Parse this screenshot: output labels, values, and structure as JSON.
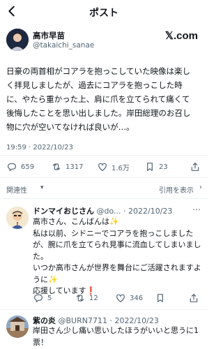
{
  "header": {
    "title": "ポスト",
    "back_icon": "arrow-left-icon"
  },
  "post": {
    "author_name": "高市早苗",
    "author_handle": "@takaichi_sanae",
    "brand_logo": "𝕏.com",
    "text_lines": [
      "日豪の両首相がコアラを抱っこしていた映像は楽し",
      "く拝見しましたが、過去にコアラを抱っこした時",
      "に、やたら重かった上、肩に爪を立てられて痛くて",
      "後悔したことを思い出しました。岸田総理のお召し",
      "物に穴が空いてなければ良いが…。"
    ],
    "timestamp": "19:59 · 2022/10/23",
    "stats": {
      "replies": "659",
      "reposts": "1317",
      "likes": "1.6万",
      "bookmarks": "23"
    }
  },
  "related": {
    "label": "関連性",
    "quote_link": "引用を表示"
  },
  "replies": [
    {
      "name": "ドンマイおじさん",
      "meta": "@do... · 2022/10/23",
      "text_lines": [
        "高市さん、こんばんは✨",
        "私は以前、シドニーでコアラを抱っこしました",
        "が、腕に爪を立てられ見事に流血してしまいまし",
        "た。",
        "いつか高市さんが世界を舞台にご活躍されますよ",
        "うに✨",
        "応援しています❗"
      ],
      "stats": {
        "replies": "5",
        "reposts": "12",
        "likes": "346",
        "bookmarks": ""
      }
    },
    {
      "name": "紫の炎",
      "meta": "@BURN7711 · 2022/10/23",
      "text_lines": [
        "岸田さん少し痛い思いしたほうがいいと思うに1",
        "票！"
      ]
    }
  ],
  "colors": {
    "text": "#0f1419",
    "secondary": "#536471",
    "divider": "#eff3f4"
  }
}
